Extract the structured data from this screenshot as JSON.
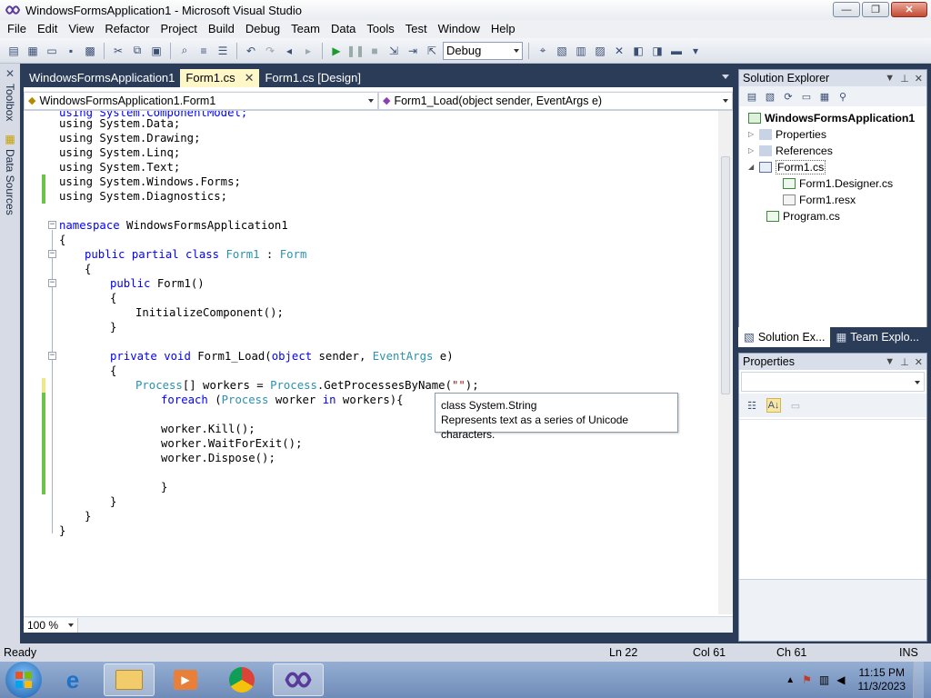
{
  "window": {
    "title": "WindowsFormsApplication1 - Microsoft Visual Studio",
    "minimize": "—",
    "restore": "❐",
    "close": "✕"
  },
  "menu": [
    "File",
    "Edit",
    "View",
    "Refactor",
    "Project",
    "Build",
    "Debug",
    "Team",
    "Data",
    "Tools",
    "Test",
    "Window",
    "Help"
  ],
  "toolbar": {
    "config": "Debug"
  },
  "left_sidebar": {
    "toolbox": "Toolbox",
    "data_sources": "Data Sources"
  },
  "doc_tabs": [
    {
      "label": "WindowsFormsApplication1",
      "active": false
    },
    {
      "label": "Form1.cs",
      "active": true
    },
    {
      "label": "Form1.cs [Design]",
      "active": false
    }
  ],
  "nav": {
    "class_combo": "WindowsFormsApplication1.Form1",
    "member_combo": "Form1_Load(object sender, EventArgs e)"
  },
  "code": {
    "lines": {
      "l1": "using System.ComponentModel;",
      "l2": "using System.Data;",
      "l3": "using System.Drawing;",
      "l4": "using System.Linq;",
      "l5": "using System.Text;",
      "l6": "using System.Windows.Forms;",
      "l7": "using System.Diagnostics;",
      "l8_kw": "namespace",
      "l8_name": " WindowsFormsApplication1",
      "brace_open": "{",
      "brace_close": "}",
      "class_kw": "public partial class",
      "class_name": "Form1",
      "colon": " : ",
      "class_base": "Form",
      "ctor_kw": "public",
      "ctor_name": " Form1()",
      "init": "InitializeComponent();",
      "method_kw1": "private",
      "method_kw2": "void",
      "method_name": " Form1_Load(",
      "method_kw3": "object",
      "method_mid": " sender, ",
      "method_type": "EventArgs",
      "method_end": " e)",
      "proc_type": "Process",
      "proc_mid": "[] workers = ",
      "proc_type2": "Process",
      "proc_call": ".GetProcessesByName(",
      "proc_str": "\"\"",
      "proc_end": ");",
      "foreach_kw": "foreach",
      "foreach_paren": " (",
      "foreach_type": "Process",
      "foreach_mid": " worker ",
      "foreach_in": "in",
      "foreach_end": " workers){",
      "kill": "worker.Kill();",
      "wait": "worker.WaitForExit();",
      "dispose": "worker.Dispose();"
    }
  },
  "tooltip": {
    "line1": "class System.String",
    "line2": "Represents text as a series of Unicode characters."
  },
  "editor_bottom": {
    "zoom": "100 %"
  },
  "solution_explorer": {
    "title": "Solution Explorer",
    "project": "WindowsFormsApplication1",
    "items": {
      "properties": "Properties",
      "references": "References",
      "form1": "Form1.cs",
      "designer": "Form1.Designer.cs",
      "resx": "Form1.resx",
      "program": "Program.cs"
    },
    "tab_solution": "Solution Ex...",
    "tab_team": "Team Explo..."
  },
  "properties_panel": {
    "title": "Properties"
  },
  "status": {
    "ready": "Ready",
    "ln": "Ln 22",
    "col": "Col 61",
    "ch": "Ch 61",
    "ins": "INS"
  },
  "taskbar": {
    "time": "11:15 PM",
    "date": "11/3/2023"
  },
  "colors": {
    "keyword": "#0000ff",
    "type": "#2b91af",
    "string": "#a31515",
    "change_saved": "#6cc24a",
    "change_unsaved": "#f0e68c",
    "chrome": "#2b3c59"
  }
}
